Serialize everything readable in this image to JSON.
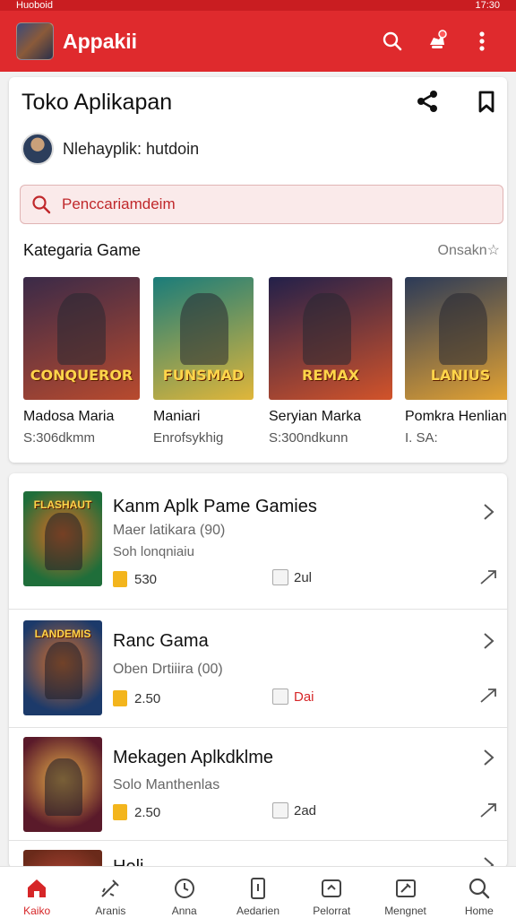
{
  "status_bar": {
    "left": "Huoboid",
    "right": "17:30"
  },
  "app_bar": {
    "title": "Appakii",
    "logo_icon": "game-logo-icon",
    "icons": [
      "search-icon",
      "notification-icon",
      "more-vert-icon"
    ]
  },
  "store": {
    "title": "Toko Aplikapan",
    "developer_label": "Nlehayplik: hutdoin",
    "search_placeholder": "Penccariamdeim",
    "section_title": "Kategaria Game",
    "section_more": "Onsakn☆",
    "games": [
      {
        "name": "Madosa Maria",
        "sub": "S:306dkmm",
        "art_label": "CONQUEROR",
        "colors": [
          "#3a2a48",
          "#b84a2e"
        ]
      },
      {
        "name": "Maniari",
        "sub": "Enrofsykhig",
        "art_label": "FUNSMAD",
        "colors": [
          "#1a7c7a",
          "#e0b63a"
        ]
      },
      {
        "name": "Seryian Marka",
        "sub": "S:300ndkunn",
        "art_label": "REMAX",
        "colors": [
          "#22204a",
          "#d2532a"
        ]
      },
      {
        "name": "Pomkra Henlian",
        "sub": "I. SA:",
        "art_label": "LANIUS",
        "colors": [
          "#2b3a58",
          "#e6a432"
        ]
      }
    ]
  },
  "app_list": [
    {
      "title": "Kanm Aplk Pame Gamies",
      "sub1": "Maer latikara (90)",
      "sub2": "Soh lonqniaiu",
      "rating": "530",
      "badge": "2ul",
      "badge_color": "#333333",
      "art_label": "FLASHAUT",
      "colors": [
        "#1f6e3a",
        "#e36a21"
      ]
    },
    {
      "title": "Ranc Gama",
      "sub1": "Oben Drtiiira (00)",
      "sub2": "",
      "rating": "2.50",
      "badge": "Dai",
      "badge_color": "#d62628",
      "art_label": "LANDEMIS",
      "colors": [
        "#1c3a6a",
        "#d9702a"
      ]
    },
    {
      "title": "Mekagen Aplkdklme",
      "sub1": "Solo Manthenlas",
      "sub2": "",
      "rating": "2.50",
      "badge": "2ad",
      "badge_color": "#333333",
      "art_label": "",
      "colors": [
        "#5a1a2a",
        "#e8b04a"
      ]
    },
    {
      "title": "Heli...",
      "sub1": "",
      "sub2": "",
      "rating": "",
      "badge": "",
      "badge_color": "#333333",
      "art_label": "",
      "colors": [
        "#6a2a1a",
        "#c04a3a"
      ]
    }
  ],
  "bottom_nav": [
    {
      "label": "Kaiko",
      "icon": "home-icon",
      "active": true
    },
    {
      "label": "Aranis",
      "icon": "wand-icon",
      "active": false
    },
    {
      "label": "Anna",
      "icon": "clock-icon",
      "active": false
    },
    {
      "label": "Aedarien",
      "icon": "phone-icon",
      "active": false
    },
    {
      "label": "Pelorrat",
      "icon": "device-icon",
      "active": false
    },
    {
      "label": "Mengnet",
      "icon": "tools-icon",
      "active": false
    },
    {
      "label": "Home",
      "icon": "search-icon",
      "active": false
    }
  ],
  "colors": {
    "accent": "#df2a2d",
    "accent_dark": "#c91d21"
  }
}
